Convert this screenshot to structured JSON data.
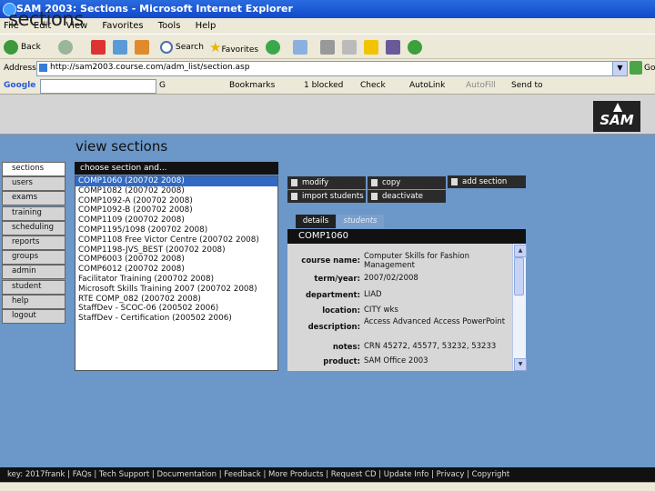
{
  "window": {
    "title": "SAM 2003: Sections - Microsoft Internet Explorer"
  },
  "menu": [
    "File",
    "Edit",
    "View",
    "Favorites",
    "Tools",
    "Help"
  ],
  "toolbar": {
    "back": "Back",
    "search": "Search",
    "favorites": "Favorites"
  },
  "address": {
    "label": "Address",
    "url": "http://sam2003.course.com/adm_list/section.asp",
    "go": "Go"
  },
  "google_bar": {
    "logo": "Google",
    "go": "G",
    "bookmarks": "Bookmarks",
    "popups": "1 blocked",
    "check": "Check",
    "autolink": "AutoLink",
    "autofill": "AutoFill",
    "send": "Send to"
  },
  "app": {
    "title": "sections",
    "logo": "SAM",
    "page_heading": "view sections"
  },
  "nav": [
    "sections",
    "users",
    "exams",
    "training",
    "scheduling",
    "reports",
    "groups",
    "admin",
    "student",
    "help",
    "logout"
  ],
  "section_list": {
    "header": "choose section and...",
    "items": [
      "COMP1060 (200702 2008)",
      "COMP1082 (200702 2008)",
      "COMP1092-A (200702 2008)",
      "COMP1092-B (200702 2008)",
      "COMP1109 (200702 2008)",
      "COMP1195/1098 (200702 2008)",
      "COMP1108 Free Victor Centre (200702 2008)",
      "COMP1198-JVS_BEST (200702 2008)",
      "COMP6003 (200702 2008)",
      "COMP6012 (200702 2008)",
      "Facilitator Training (200702 2008)",
      "Microsoft Skills Training 2007 (200702 2008)",
      "RTE COMP_082 (200702 2008)",
      "StaffDev - SCOC-06 (200502 2006)",
      "StaffDev - Certification (200502 2006)"
    ]
  },
  "actions": {
    "modify": "modify",
    "copy": "copy",
    "add_section": "add section",
    "import_students": "import students",
    "deactivate": "deactivate"
  },
  "tabs": {
    "details": "details",
    "students": "students"
  },
  "details": {
    "header": "COMP1060",
    "fields": [
      {
        "label": "course name:",
        "value": "Computer Skills for Fashion Management"
      },
      {
        "label": "term/year:",
        "value": "2007/02/2008"
      },
      {
        "label": "department:",
        "value": "LIAD"
      },
      {
        "label": "location:",
        "value": "CITY wks"
      },
      {
        "label": "description:",
        "value": "Access Advanced Access PowerPoint"
      },
      {
        "label": "notes:",
        "value": "CRN 45272, 45577, 53232, 53233"
      },
      {
        "label": "product:",
        "value": "SAM Office 2003"
      }
    ]
  },
  "footer": "key: 2017frank  |  FAQs  |  Tech Support  |  Documentation  |  Feedback  |  More Products  |  Request CD  |  Update Info  |  Privacy  |  Copyright"
}
